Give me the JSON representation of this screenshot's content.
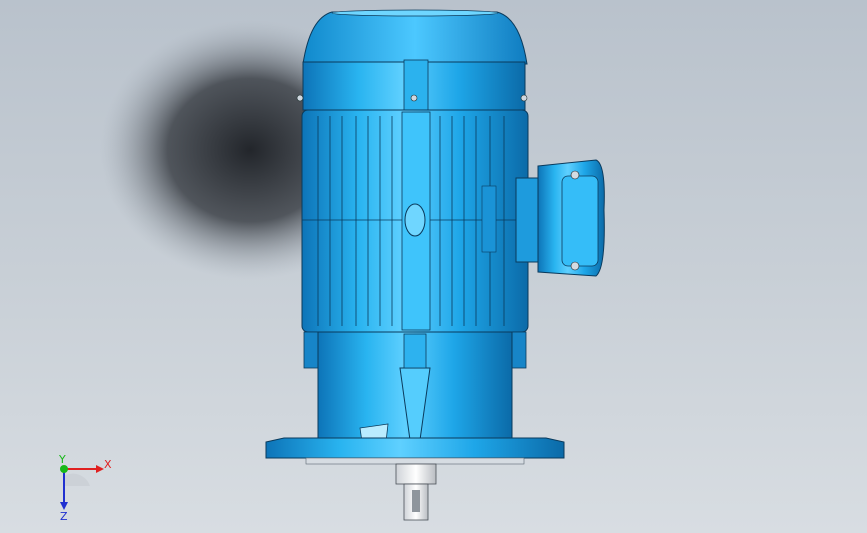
{
  "app": {
    "view": "cad-3d-viewport"
  },
  "model": {
    "name": "",
    "color": "#1ea6e8"
  },
  "triad": {
    "x_label": "X",
    "y_label": "Y",
    "z_label": "Z",
    "x_color": "#e02020",
    "y_color": "#18b818",
    "z_color": "#2030d0"
  }
}
